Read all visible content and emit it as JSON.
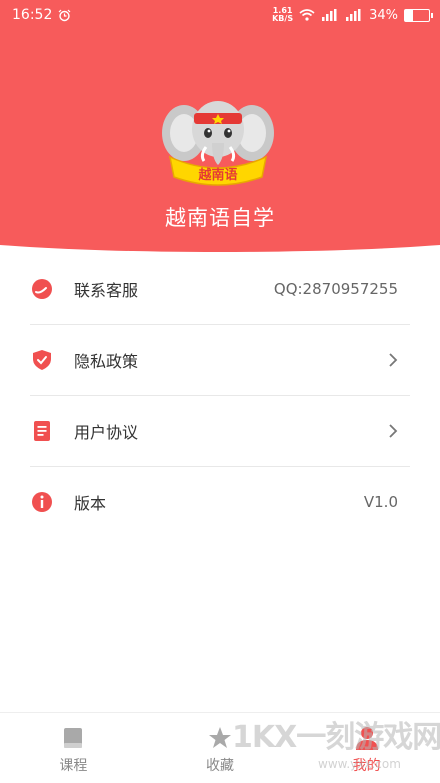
{
  "status_bar": {
    "time": "16:52",
    "net_speed_value": "1.61",
    "net_speed_unit": "KB/S",
    "battery_percent": "34%",
    "battery_level": 0.34
  },
  "header": {
    "logo_text": "越南语",
    "app_name": "越南语自学"
  },
  "menu": {
    "service": {
      "label": "联系客服",
      "value": "QQ:2870957255"
    },
    "privacy": {
      "label": "隐私政策"
    },
    "agreement": {
      "label": "用户协议"
    },
    "version": {
      "label": "版本",
      "value": "V1.0"
    }
  },
  "tabs": [
    {
      "label": "课程"
    },
    {
      "label": "收藏"
    },
    {
      "label": "我的"
    }
  ],
  "watermark": {
    "text": "1KX一刻游戏网",
    "sub": "www.yxx.com"
  },
  "colors": {
    "accent": "#f75b5b",
    "active_tab": "#f05050"
  }
}
